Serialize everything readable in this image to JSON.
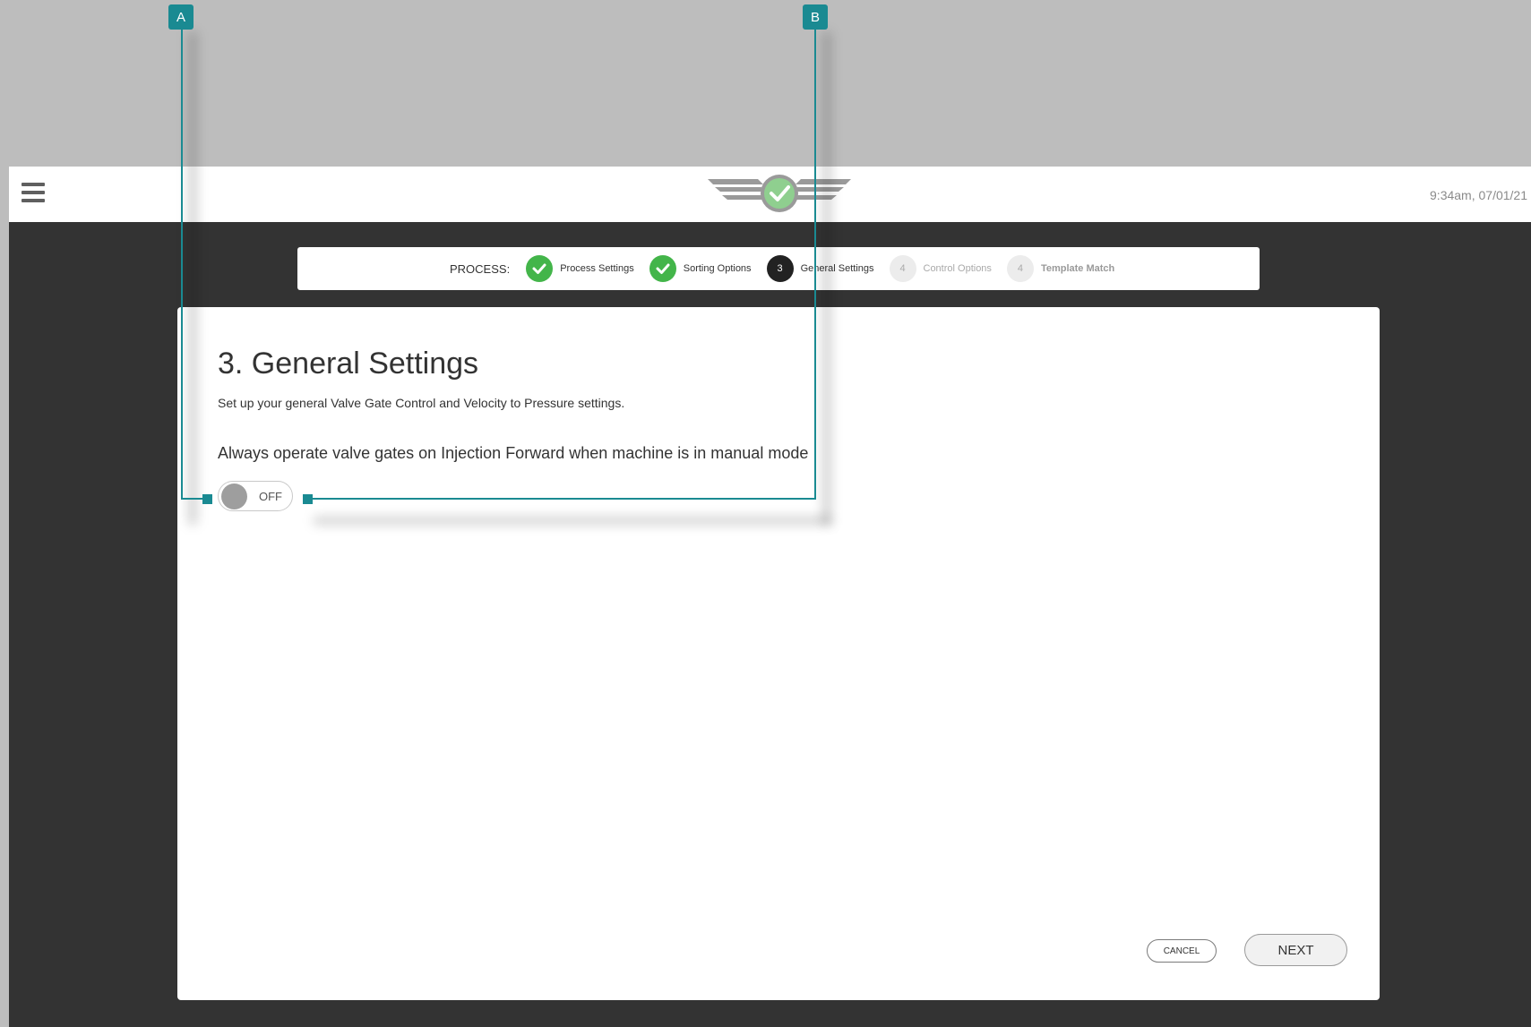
{
  "header": {
    "menu_icon": "hamburger-icon",
    "logo": "winged-check-logo",
    "timestamp": "9:34am, 07/01/21"
  },
  "stepper": {
    "label": "PROCESS:",
    "steps": [
      {
        "marker": "",
        "label": "Process Settings",
        "state": "done"
      },
      {
        "marker": "",
        "label": "Sorting Options",
        "state": "done"
      },
      {
        "marker": "3",
        "label": "General Settings",
        "state": "active"
      },
      {
        "marker": "4",
        "label": "Control Options",
        "state": "todo"
      },
      {
        "marker": "4",
        "label": "Template Match",
        "state": "todo"
      }
    ]
  },
  "main": {
    "title": "3. General Settings",
    "subtitle": "Set up your general Valve Gate Control and Velocity to Pressure settings.",
    "setting_label": "Always operate valve gates on Injection Forward when machine is in manual mode",
    "toggle": {
      "state_label": "OFF",
      "on": false
    }
  },
  "buttons": {
    "cancel": "CANCEL",
    "next": "NEXT"
  },
  "callouts": {
    "a": "A",
    "b": "B",
    "color": "#1a8a92"
  },
  "colors": {
    "step_done": "#43b54a",
    "step_active": "#222222",
    "background_frame": "#333333"
  }
}
